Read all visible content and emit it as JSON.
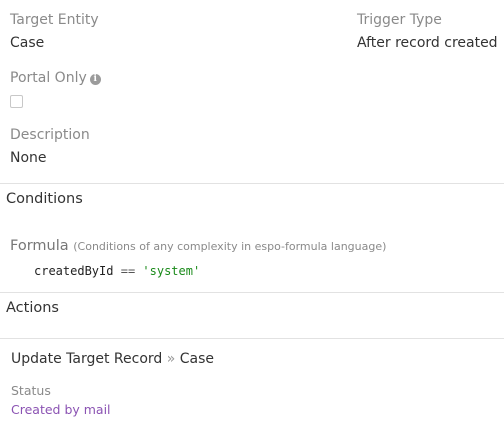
{
  "fields": {
    "target_entity": {
      "label": "Target Entity",
      "value": "Case"
    },
    "trigger_type": {
      "label": "Trigger Type",
      "value": "After record created"
    },
    "portal_only": {
      "label": "Portal Only",
      "info_icon": "info-circle-icon",
      "checked": false
    },
    "description": {
      "label": "Description",
      "value": "None"
    }
  },
  "conditions": {
    "title": "Conditions",
    "formula": {
      "title": "Formula",
      "hint": "(Conditions of any complexity in espo-formula language)",
      "code": {
        "field": "createdById",
        "operator": "==",
        "string": "'system'"
      }
    }
  },
  "actions": {
    "title": "Actions",
    "items": [
      {
        "type": "Update Target Record",
        "separator": "»",
        "target": "Case",
        "field_label": "Status",
        "field_value": "Created by mail"
      }
    ]
  },
  "colors": {
    "link": "#8b53b3",
    "string_literal": "#1a8a1a",
    "divider": "#e2e2e2"
  }
}
